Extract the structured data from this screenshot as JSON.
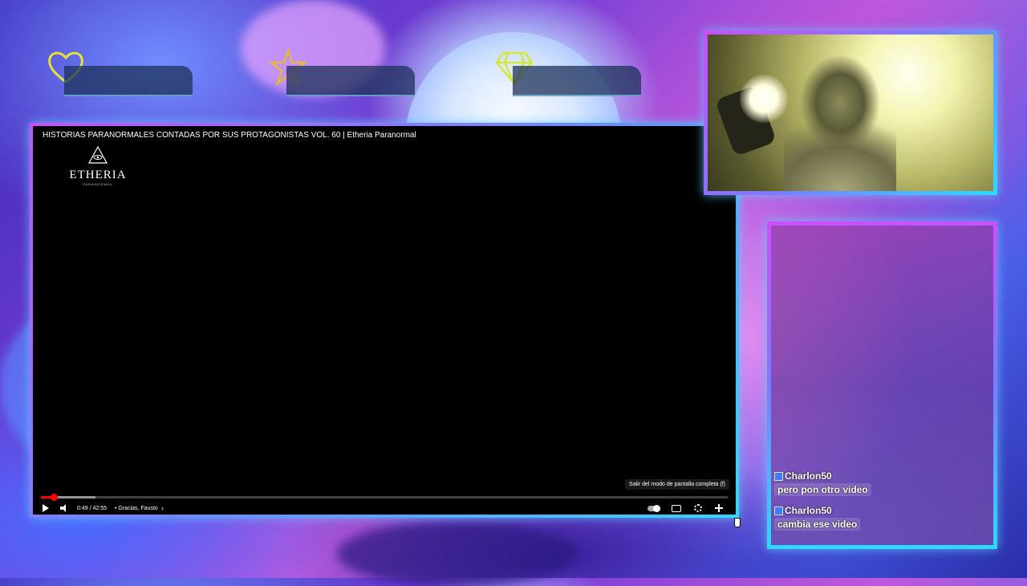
{
  "stats": [
    {
      "icon": "heart-icon",
      "color": "#e6e03a",
      "value": ""
    },
    {
      "icon": "star-icon",
      "color": "#e6b83a",
      "value": ""
    },
    {
      "icon": "diamond-icon",
      "color": "#d6e63a",
      "value": ""
    }
  ],
  "player": {
    "title": "HISTORIAS PARANORMALES CONTADAS POR SUS PROTAGONISTAS VOL. 60 | Etheria Paranormal",
    "logo_name": "ETHERIA",
    "logo_sub": "PARANORMAL",
    "time": "0:49 / 42:55",
    "chapter": "• Gracias, Fausto",
    "chapter_arrow": "›",
    "tooltip": "Salir del modo de pantalla completa (f)",
    "progress_played": 0.019,
    "progress_loaded": 0.08,
    "accent": "#ff0000"
  },
  "chat": {
    "messages": [
      {
        "user": "Charlon50",
        "text": "pero pon otro video"
      },
      {
        "user": "Charlon50",
        "text": "cambia ese video"
      }
    ]
  }
}
